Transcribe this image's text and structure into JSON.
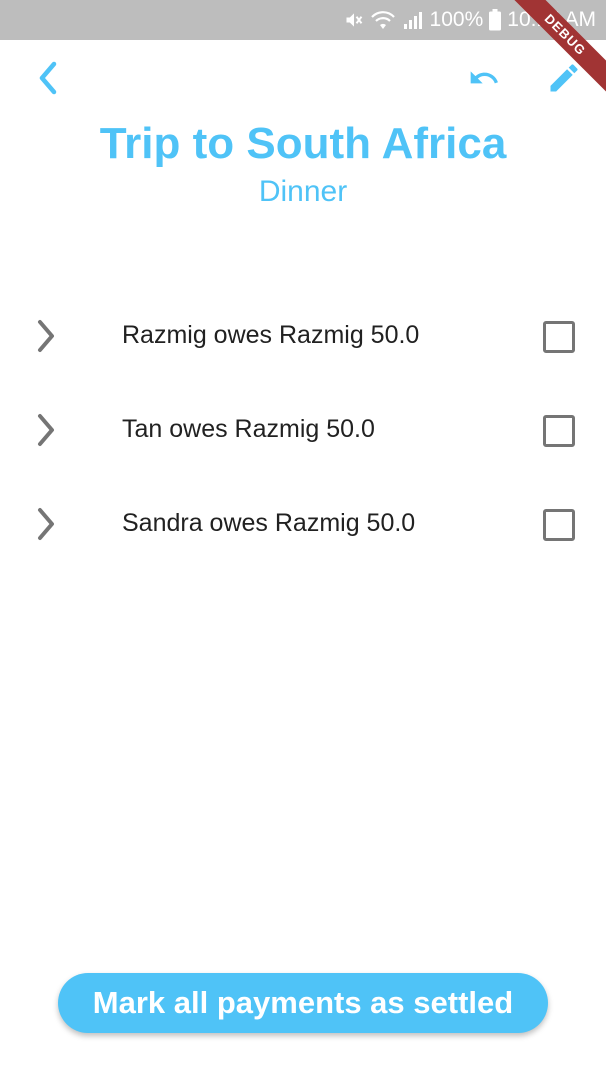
{
  "status_bar": {
    "icons": [
      "mute-icon",
      "wifi-icon",
      "signal-icon",
      "battery-icon"
    ],
    "battery": "100%",
    "time": "10:15 AM"
  },
  "debug_banner": "DEBUG",
  "toolbar": {
    "back_icon": "chevron-left-icon",
    "undo_icon": "undo-icon",
    "edit_icon": "pencil-icon"
  },
  "header": {
    "title": "Trip to South Africa",
    "subtitle": "Dinner"
  },
  "payments": [
    {
      "text": "Razmig owes Razmig 50.0",
      "settled": false
    },
    {
      "text": "Tan owes Razmig 50.0",
      "settled": false
    },
    {
      "text": "Sandra owes Razmig 50.0",
      "settled": false
    }
  ],
  "actions": {
    "settle_all_label": "Mark all payments as settled"
  },
  "colors": {
    "accent": "#4fc3f7",
    "status_bar": "#bdbdbd",
    "text": "#212121",
    "icon_grey": "#757575",
    "debug_ribbon": "#a13434"
  }
}
